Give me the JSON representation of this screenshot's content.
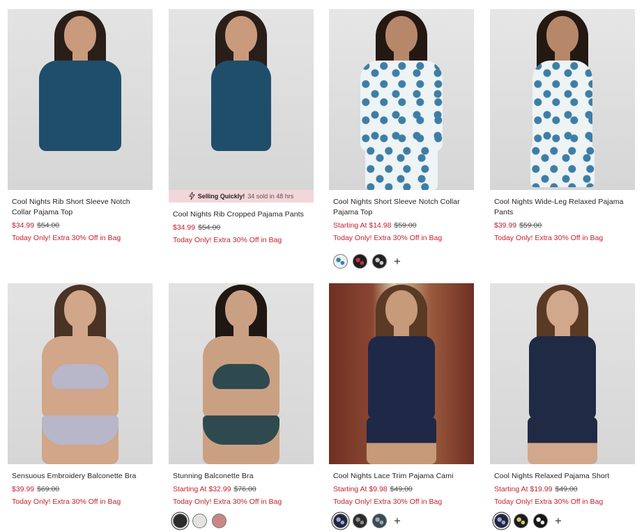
{
  "products": [
    {
      "title": "Cool Nights Rib Short Sleeve Notch Collar Pajama Top",
      "price": "$34.99",
      "original_price": "$54.00",
      "promo": "Today Only! Extra 30% Off in Bag",
      "image_colors": {
        "bg": "#e3e3e3",
        "garment": "#1f4e6b",
        "skin": "#c99a7c",
        "hair": "#2a1e18"
      }
    },
    {
      "title": "Cool Nights Rib Cropped Pajama Pants",
      "price": "$34.99",
      "original_price": "$54.00",
      "promo": "Today Only! Extra 30% Off in Bag",
      "badge": {
        "icon": "lightning-icon",
        "label": "Selling Quickly!",
        "detail": "34 sold in 48 hrs"
      },
      "image_colors": {
        "bg": "#e4e4e4",
        "garment": "#1f4e6b",
        "skin": "#c99a7c",
        "hair": "#2a1e18"
      }
    },
    {
      "title": "Cool Nights Short Sleeve Notch Collar Pajama Top",
      "price": "Starting At $14.98",
      "original_price": "$59.00",
      "promo": "Today Only! Extra 30% Off in Bag",
      "swatches": [
        {
          "name": "white-floral-swatch",
          "color": "#e9f1f4",
          "accent": "#3f7fa3"
        },
        {
          "name": "black-red-swatch",
          "color": "#1d1d1f",
          "accent": "#c03040"
        },
        {
          "name": "black-floral-swatch",
          "color": "#222222",
          "accent": "#cccccc"
        }
      ],
      "more_label": "+",
      "image_colors": {
        "bg": "#e6e6e6",
        "garment": "#eef3f4",
        "pattern": "#3d7ea6",
        "skin": "#b7876a",
        "hair": "#241812"
      }
    },
    {
      "title": "Cool Nights Wide-Leg Relaxed Pajama Pants",
      "price": "$39.99",
      "original_price": "$59.00",
      "promo": "Today Only! Extra 30% Off in Bag",
      "image_colors": {
        "bg": "#e6e6e6",
        "garment": "#eef3f4",
        "pattern": "#3d7ea6",
        "skin": "#b7876a",
        "hair": "#241812"
      }
    },
    {
      "title": "Sensuous Embroidery Balconette Bra",
      "price": "$39.99",
      "original_price": "$69.00",
      "promo": "Today Only! Extra 30% Off in Bag",
      "image_colors": {
        "bg": "#e3e3e3",
        "garment": "#b8b6c9",
        "skin": "#d1a689",
        "hair": "#4a3324"
      }
    },
    {
      "title": "Stunning Balconette Bra",
      "price": "Starting At $32.99",
      "original_price": "$76.00",
      "promo": "Today Only! Extra 30% Off in Bag",
      "swatches": [
        {
          "name": "black-swatch",
          "color": "#2b2b2b",
          "accent": "#2b2b2b",
          "selected": true
        },
        {
          "name": "light-grey-swatch",
          "color": "#e4e1de",
          "accent": "#e4e1de"
        },
        {
          "name": "rose-swatch",
          "color": "#c98685",
          "accent": "#c98685"
        }
      ],
      "image_colors": {
        "bg": "#e2e2e2",
        "garment": "#2e4a4f",
        "skin": "#caa083",
        "hair": "#1f1712"
      }
    },
    {
      "title": "Cool Nights Lace Trim Pajama Cami",
      "price": "Starting At $9.98",
      "original_price": "$49.00",
      "promo": "Today Only! Extra 30% Off in Bag",
      "swatches": [
        {
          "name": "navy-floral-swatch",
          "color": "#1f2642",
          "accent": "#9aa6c8",
          "selected": true
        },
        {
          "name": "black-print-swatch",
          "color": "#2b2b2b",
          "accent": "#888888"
        },
        {
          "name": "slate-print-swatch",
          "color": "#3b4a55",
          "accent": "#9aa5ad"
        }
      ],
      "more_label": "+",
      "image_colors": {
        "bg": "#7a3a2a",
        "garment": "#1f2847",
        "skin": "#c79a7a",
        "hair": "#5a3a24"
      }
    },
    {
      "title": "Cool Nights Relaxed Pajama Short",
      "price": "Starting At $19.99",
      "original_price": "$49.00",
      "promo": "Today Only! Extra 30% Off in Bag",
      "swatches": [
        {
          "name": "navy-floral-swatch",
          "color": "#1f2642",
          "accent": "#9aa6c8",
          "selected": true
        },
        {
          "name": "black-floral-swatch",
          "color": "#1b1b1b",
          "accent": "#d8c86a"
        },
        {
          "name": "black-white-swatch",
          "color": "#151515",
          "accent": "#f2f2f2"
        }
      ],
      "more_label": "+",
      "image_colors": {
        "bg": "#e3e3e3",
        "garment": "#1f2a44",
        "skin": "#d2a88c",
        "hair": "#5a3a24"
      }
    }
  ]
}
